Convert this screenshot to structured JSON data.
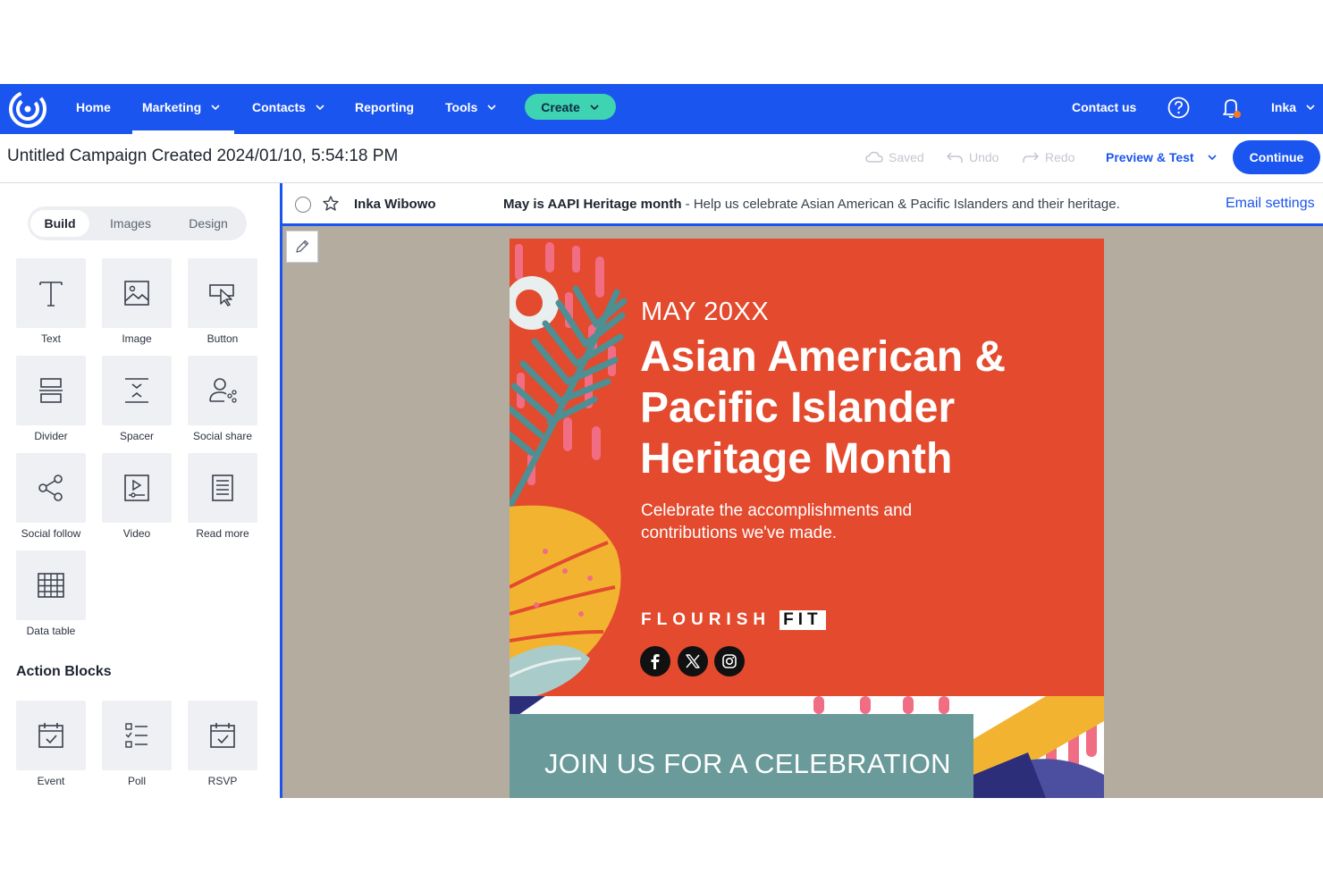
{
  "nav": {
    "items": [
      {
        "label": "Home"
      },
      {
        "label": "Marketing"
      },
      {
        "label": "Contacts"
      },
      {
        "label": "Reporting"
      },
      {
        "label": "Tools"
      }
    ],
    "create_label": "Create",
    "contact_label": "Contact us",
    "user_label": "Inka",
    "bg_color": "#1b55ef",
    "create_color": "#3ed3b1"
  },
  "header": {
    "campaign_title": "Untitled Campaign Created 2024/01/10, 5:54:18 PM",
    "saved_label": "Saved",
    "undo_label": "Undo",
    "redo_label": "Redo",
    "preview_label": "Preview & Test",
    "continue_label": "Continue"
  },
  "left_panel": {
    "tabs": [
      {
        "label": "Build",
        "active": true
      },
      {
        "label": "Images",
        "active": false
      },
      {
        "label": "Design",
        "active": false
      }
    ],
    "blocks": [
      {
        "label": "Text",
        "icon": "text-icon"
      },
      {
        "label": "Image",
        "icon": "image-icon"
      },
      {
        "label": "Button",
        "icon": "button-cursor-icon"
      },
      {
        "label": "Divider",
        "icon": "divider-icon"
      },
      {
        "label": "Spacer",
        "icon": "spacer-icon"
      },
      {
        "label": "Social share",
        "icon": "social-share-icon"
      },
      {
        "label": "Social follow",
        "icon": "social-follow-icon"
      },
      {
        "label": "Video",
        "icon": "video-icon"
      },
      {
        "label": "Read more",
        "icon": "read-more-icon"
      },
      {
        "label": "Data table",
        "icon": "data-table-icon"
      }
    ],
    "action_title": "Action Blocks",
    "action_blocks": [
      {
        "label": "Event",
        "icon": "calendar-check-icon"
      },
      {
        "label": "Poll",
        "icon": "poll-list-icon"
      },
      {
        "label": "RSVP",
        "icon": "calendar-check-icon"
      }
    ]
  },
  "infobar": {
    "sender": "Inka Wibowo",
    "subject_bold": "May is AAPI Heritage month",
    "subject_rest": " - Help us celebrate Asian American & Pacific Islanders and their heritage.",
    "settings_label": "Email settings"
  },
  "email": {
    "date": "MAY 20XX",
    "headline": "Asian American & Pacific Islander Heritage Month",
    "subtitle": "Celebrate the accomplishments and contributions we've made.",
    "brand_main": "FLOURISH",
    "brand_fit": "FIT",
    "social": [
      "facebook-icon",
      "x-twitter-icon",
      "instagram-icon"
    ],
    "join_text": "JOIN US FOR A CELEBRATION",
    "bg_color": "#e34a2e",
    "canvas_color": "#b4ad9f",
    "join_color": "#6a9a9a"
  }
}
